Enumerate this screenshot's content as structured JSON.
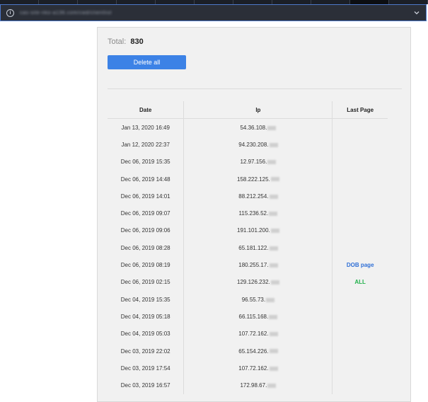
{
  "browser": {
    "url_text": "cas-site-nko-a136.com/cwd/clientlist",
    "info_icon": "info-icon",
    "dropdown_icon": "chevron-down-icon"
  },
  "summary": {
    "total_label": "Total:",
    "total_value": "830"
  },
  "actions": {
    "delete_all_label": "Delete all",
    "accent_color": "#3c82e6"
  },
  "table": {
    "headers": {
      "date": "Date",
      "ip": "Ip",
      "last_page": "Last Page"
    },
    "rows": [
      {
        "date": "Jan 13, 2020 16:49",
        "ip": "54.36.108.",
        "last_page": ""
      },
      {
        "date": "Jan 12, 2020 22:37",
        "ip": "94.230.208.",
        "last_page": ""
      },
      {
        "date": "Dec 06, 2019 15:35",
        "ip": "12.97.156.",
        "last_page": ""
      },
      {
        "date": "Dec 06, 2019 14:48",
        "ip": "158.222.125.",
        "last_page": ""
      },
      {
        "date": "Dec 06, 2019 14:01",
        "ip": "88.212.254.",
        "last_page": ""
      },
      {
        "date": "Dec 06, 2019 09:07",
        "ip": "115.236.52.",
        "last_page": ""
      },
      {
        "date": "Dec 06, 2019 09:06",
        "ip": "191.101.200.",
        "last_page": ""
      },
      {
        "date": "Dec 06, 2019 08:28",
        "ip": "65.181.122.",
        "last_page": ""
      },
      {
        "date": "Dec 06, 2019 08:19",
        "ip": "180.255.17.",
        "last_page": "DOB page"
      },
      {
        "date": "Dec 06, 2019 02:15",
        "ip": "129.126.232.",
        "last_page": "ALL"
      },
      {
        "date": "Dec 04, 2019 15:35",
        "ip": "96.55.73.",
        "last_page": ""
      },
      {
        "date": "Dec 04, 2019 05:18",
        "ip": "66.115.168.",
        "last_page": ""
      },
      {
        "date": "Dec 04, 2019 05:03",
        "ip": "107.72.162.",
        "last_page": ""
      },
      {
        "date": "Dec 03, 2019 22:02",
        "ip": "65.154.226.",
        "last_page": ""
      },
      {
        "date": "Dec 03, 2019 17:54",
        "ip": "107.72.162.",
        "last_page": ""
      },
      {
        "date": "Dec 03, 2019 16:57",
        "ip": "172.98.67.",
        "last_page": ""
      }
    ],
    "page_link_color": "#2f6fd6",
    "page_all_color": "#22b14c"
  }
}
